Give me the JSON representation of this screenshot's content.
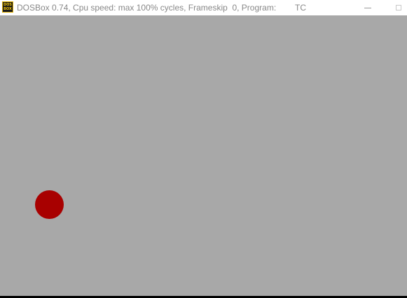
{
  "window": {
    "icon_name": "dosbox-icon",
    "icon_text_top": "DOS",
    "icon_text_bottom": "BOX",
    "title": "DOSBox 0.74, Cpu speed: max 100% cycles, Frameskip  0, Program:",
    "program": "TC",
    "controls": {
      "minimize_icon": "minimize-icon",
      "maximize_icon": "maximize-icon"
    }
  },
  "screen": {
    "background_color": "#a8a8a8",
    "ball_color": "#a80000"
  }
}
